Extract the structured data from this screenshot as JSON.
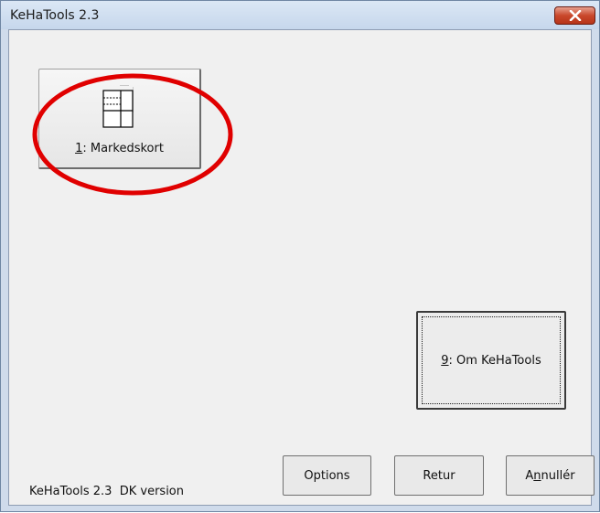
{
  "window": {
    "title": "KeHaTools 2.3",
    "close_glyph": "✕"
  },
  "tiles": [
    {
      "shortcut": "1",
      "label": ": Markedskort",
      "icon": "table-sheet-icon"
    }
  ],
  "about_button": {
    "shortcut": "9",
    "label": ": Om KeHaTools"
  },
  "buttons": {
    "options": "Options",
    "retur": "Retur",
    "annuller_pre": "A",
    "annuller_key": "n",
    "annuller_post": "nullér"
  },
  "status": {
    "text": "KeHaTools 2.3  DK version"
  },
  "annotation": {
    "color": "#e00000",
    "shape": "ellipse"
  }
}
